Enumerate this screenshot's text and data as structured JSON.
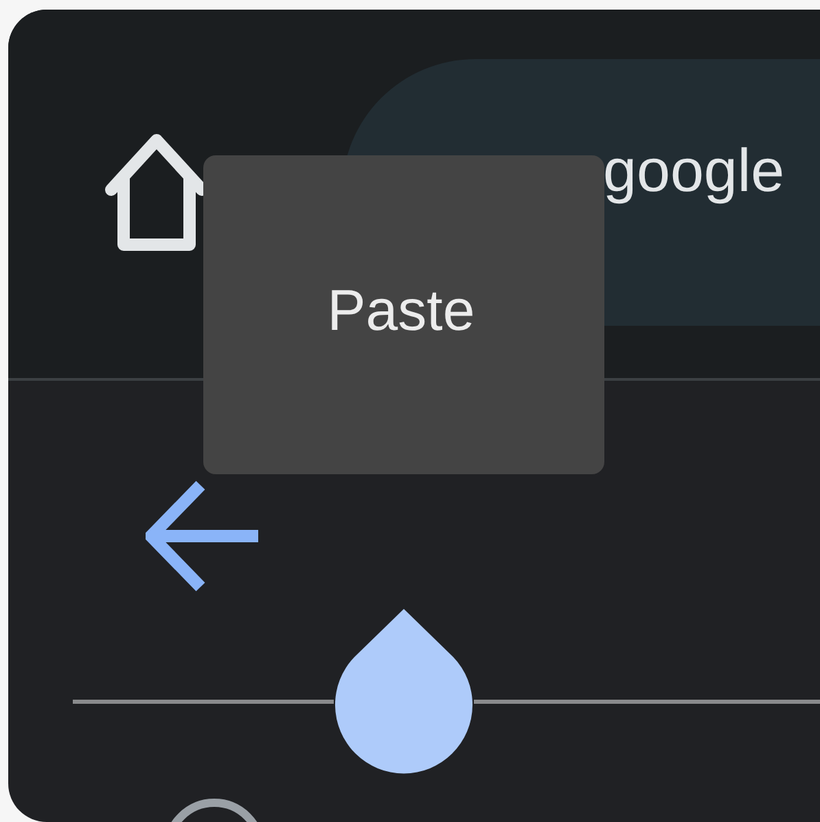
{
  "toolbar": {
    "address": "google"
  },
  "context_menu": {
    "items": [
      {
        "label": "Paste"
      }
    ]
  }
}
